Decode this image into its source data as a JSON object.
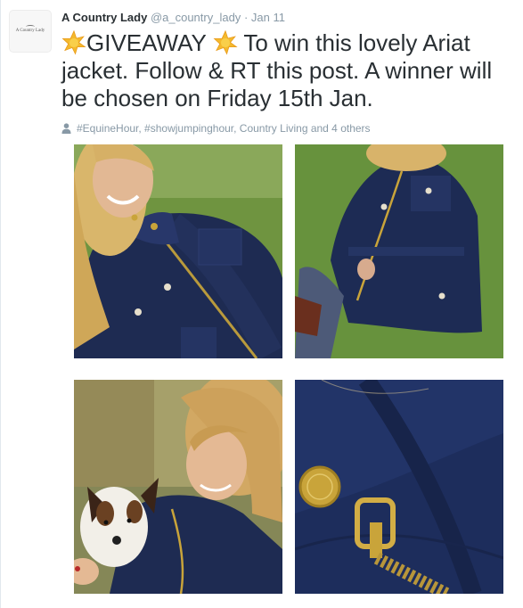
{
  "tweet": {
    "author_name": "A Country Lady",
    "author_handle": "@a_country_lady",
    "separator": "·",
    "timestamp": "Jan 11",
    "avatar_text": "A Country Lady",
    "text_part1": "GIVEAWAY ",
    "text_part2": " To win this lovely Ariat jacket. Follow & RT this post. A winner will be chosen on Friday 15th Jan.",
    "tagged_people": "#EquineHour, #showjumpinghour, Country Living and 4 others"
  },
  "photos": [
    {
      "name": "photo-woman-smiling-jacket"
    },
    {
      "name": "photo-woman-jacket-standing"
    },
    {
      "name": "photo-woman-with-puppy"
    },
    {
      "name": "photo-jacket-button-zipper-closeup"
    }
  ],
  "colors": {
    "text_primary": "#292f33",
    "text_secondary": "#8899a6",
    "jacket_navy": "#1f2d55",
    "grass_green": "#5f8a3a",
    "brass": "#c9a43a"
  },
  "icons": {
    "emoji": "star-emoji-icon",
    "tagged": "person-icon"
  }
}
